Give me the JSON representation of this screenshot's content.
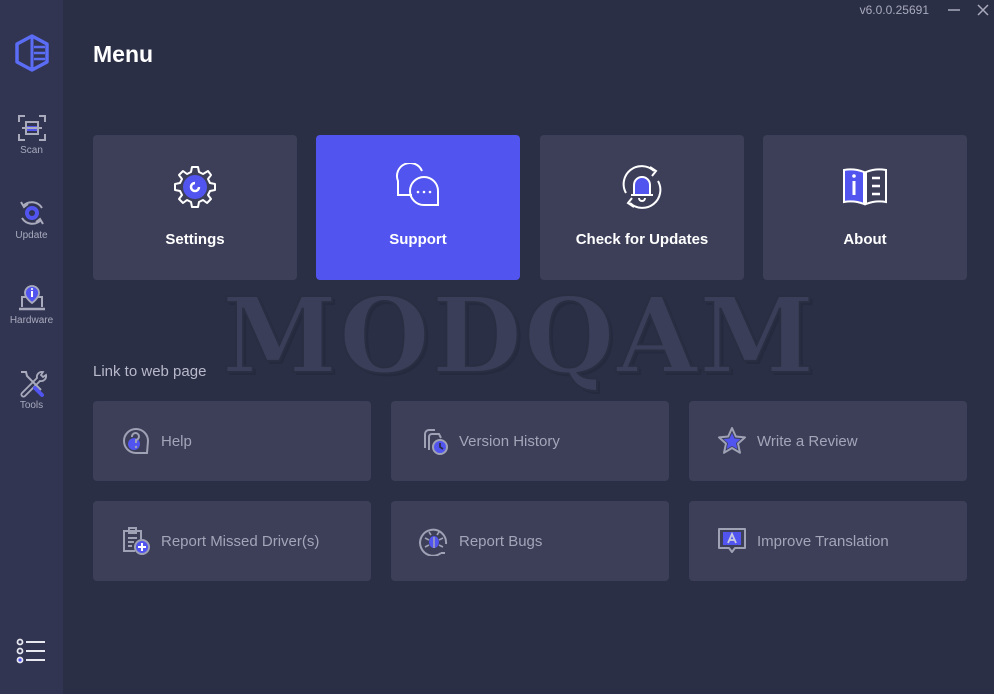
{
  "window": {
    "version": "v6.0.0.25691",
    "minimize_label": "minimize",
    "close_label": "close"
  },
  "sidebar": {
    "items": [
      {
        "label": "Scan",
        "icon": "scan-icon"
      },
      {
        "label": "Update",
        "icon": "update-icon"
      },
      {
        "label": "Hardware",
        "icon": "hardware-icon"
      },
      {
        "label": "Tools",
        "icon": "tools-icon"
      }
    ],
    "menu_icon": "menu-list-icon"
  },
  "header": {
    "title": "Menu"
  },
  "cards": [
    {
      "label": "Settings",
      "icon": "settings-gear-icon",
      "active": false
    },
    {
      "label": "Support",
      "icon": "support-chat-icon",
      "active": true
    },
    {
      "label": "Check for Updates",
      "icon": "bell-refresh-icon",
      "active": false
    },
    {
      "label": "About",
      "icon": "book-info-icon",
      "active": false
    }
  ],
  "links_section": {
    "title": "Link to web page",
    "items": [
      {
        "label": "Help",
        "icon": "help-question-icon"
      },
      {
        "label": "Version History",
        "icon": "version-history-icon"
      },
      {
        "label": "Write a Review",
        "icon": "star-icon"
      },
      {
        "label": "Report Missed Driver(s)",
        "icon": "clipboard-plus-icon"
      },
      {
        "label": "Report Bugs",
        "icon": "bug-icon"
      },
      {
        "label": "Improve Translation",
        "icon": "translation-icon"
      }
    ]
  },
  "watermark": "MODQAM",
  "colors": {
    "accent": "#5154ee",
    "background": "#2b2f46",
    "sidebar": "#313552",
    "card": "#3d3f59"
  }
}
